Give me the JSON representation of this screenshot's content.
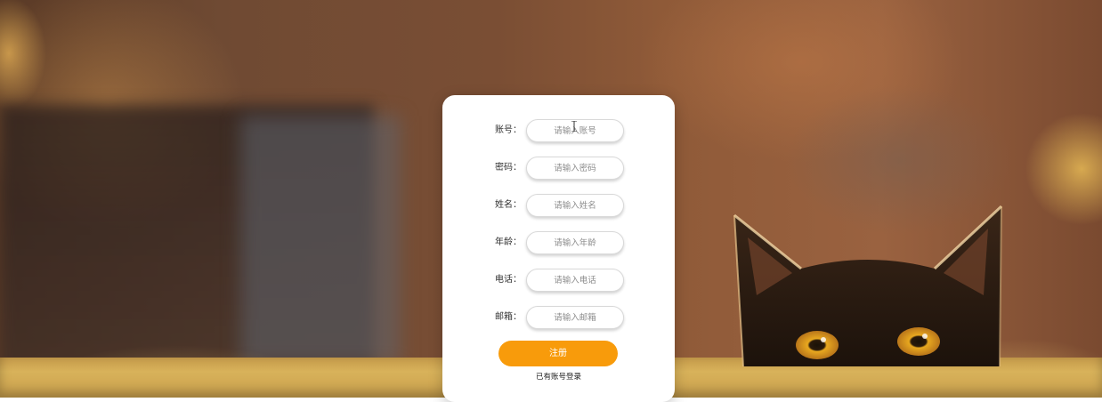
{
  "form": {
    "fields": [
      {
        "label": "账号：",
        "placeholder": "请输入账号"
      },
      {
        "label": "密码：",
        "placeholder": "请输入密码"
      },
      {
        "label": "姓名：",
        "placeholder": "请输入姓名"
      },
      {
        "label": "年龄：",
        "placeholder": "请输入年龄"
      },
      {
        "label": "电话：",
        "placeholder": "请输入电话"
      },
      {
        "label": "邮箱：",
        "placeholder": "请输入邮箱"
      }
    ],
    "register_label": "注册",
    "login_link_label": "已有账号登录"
  },
  "colors": {
    "accent": "#f89b0b",
    "card": "#ffffff",
    "input_border": "#d9d9d9",
    "placeholder": "#8c8c8c"
  },
  "background": {
    "description_icon": "cat-photo-background"
  }
}
